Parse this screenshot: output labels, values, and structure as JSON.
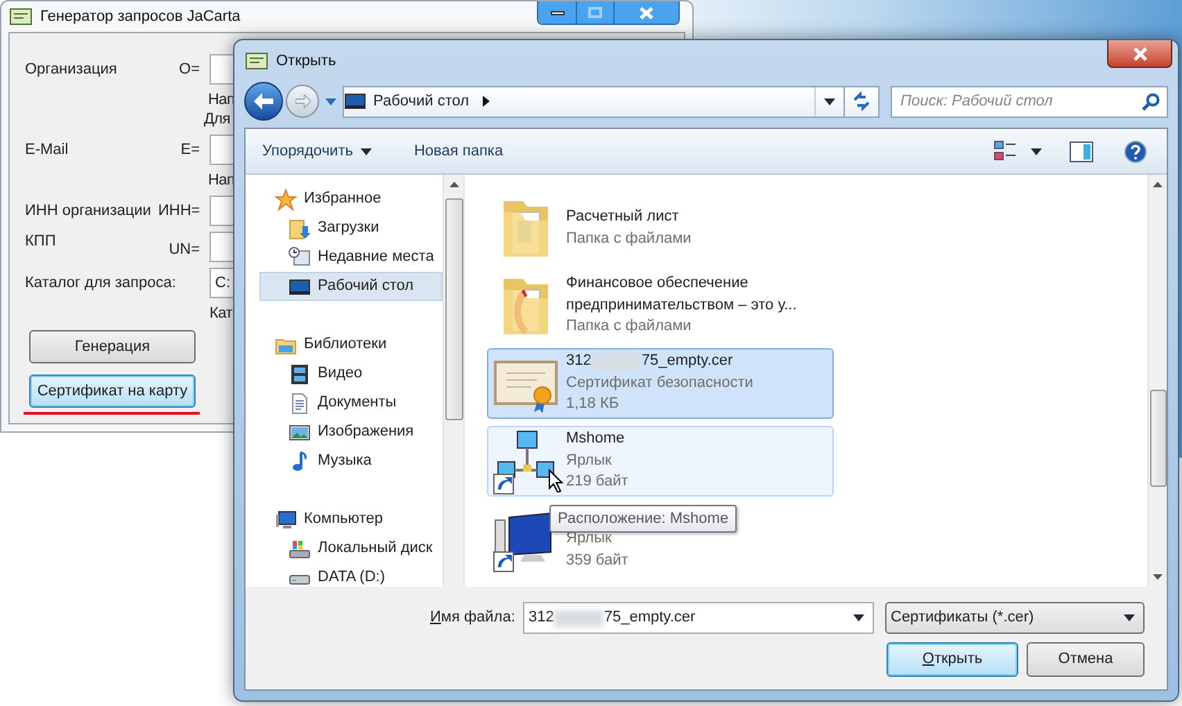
{
  "jacarta": {
    "title": "Генератор запросов JaCarta",
    "fields": [
      {
        "label": "Организация",
        "prefix": "O=",
        "hints": [
          "Нап",
          "Для"
        ]
      },
      {
        "label": "E-Mail",
        "prefix": "E=",
        "hints": [
          "Нап"
        ]
      },
      {
        "label": "ИНН организации",
        "prefix": "ИНН="
      },
      {
        "label": "КПП",
        "prefix": "UN="
      }
    ],
    "folder": {
      "label": "Каталог для запроса:",
      "value": "C:",
      "hint": "Кат"
    },
    "buttons": [
      {
        "label": "Генерация",
        "focused": false,
        "underlined": false
      },
      {
        "label": "Сертификат на карту",
        "focused": true,
        "underlined": true
      }
    ]
  },
  "dialog": {
    "title": "Открыть",
    "address": "Рабочий стол",
    "search": {
      "placeholder": "Поиск: Рабочий стол"
    },
    "toolbar": {
      "organize": "Упорядочить",
      "new_folder": "Новая папка"
    },
    "sidebar": [
      {
        "label": "Избранное",
        "kind": "star",
        "selected": false,
        "children": [
          {
            "label": "Загрузки",
            "kind": "downloads",
            "selected": false
          },
          {
            "label": "Недавние места",
            "kind": "recent",
            "selected": false
          },
          {
            "label": "Рабочий стол",
            "kind": "desktop",
            "selected": true
          }
        ]
      },
      {
        "label": "Библиотеки",
        "kind": "library",
        "selected": false,
        "children": [
          {
            "label": "Видео",
            "kind": "video",
            "selected": false
          },
          {
            "label": "Документы",
            "kind": "document",
            "selected": false
          },
          {
            "label": "Изображения",
            "kind": "pictures",
            "selected": false
          },
          {
            "label": "Музыка",
            "kind": "music",
            "selected": false
          }
        ]
      },
      {
        "label": "Компьютер",
        "kind": "computer",
        "selected": false,
        "children": [
          {
            "label": "Локальный диск",
            "kind": "system-disk",
            "selected": false
          },
          {
            "label": "DATA (D:)",
            "kind": "disk",
            "selected": false
          }
        ]
      }
    ],
    "files": [
      {
        "kind": "folder",
        "name": "Расчетный лист",
        "lines": [
          "Папка с файлами"
        ],
        "selected": false,
        "hovered": false
      },
      {
        "kind": "folder-red",
        "name": "Финансовое обеспечение предпринимательством – это у...",
        "lines": [
          "Папка с файлами"
        ],
        "selected": false,
        "hovered": false
      },
      {
        "kind": "certificate",
        "name_prefix": "312",
        "name_suffix": "75_empty.cer",
        "lines": [
          "Сертификат безопасности",
          "1,18 КБ"
        ],
        "selected": true,
        "hovered": false
      },
      {
        "kind": "network-shortcut",
        "name": "Mshome",
        "lines": [
          "Ярлык",
          "219 байт"
        ],
        "selected": false,
        "hovered": true
      },
      {
        "kind": "computer-shortcut",
        "lines": [
          "Ярлык",
          "359 байт"
        ],
        "selected": false,
        "hovered": false
      }
    ],
    "tooltip": "Расположение: Mshome",
    "filename": {
      "label": "Имя файла:",
      "value_prefix": "312",
      "value_suffix": "75_empty.cer"
    },
    "filter": "Сертификаты (*.cer)",
    "buttons": [
      {
        "label": "Открыть",
        "default": true
      },
      {
        "label": "Отмена",
        "default": false
      }
    ]
  }
}
